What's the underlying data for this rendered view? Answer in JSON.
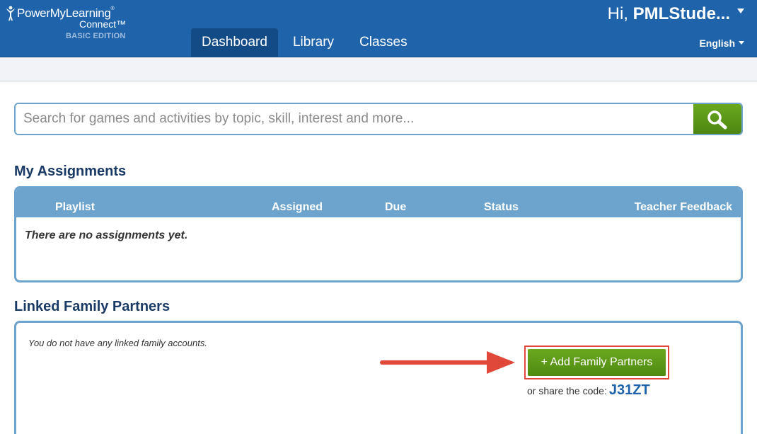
{
  "header": {
    "logo": {
      "brand": "PowerMyLearning",
      "registered": "®",
      "product": "Connect™",
      "edition": "BASIC EDITION"
    },
    "nav": [
      {
        "label": "Dashboard",
        "active": true
      },
      {
        "label": "Library",
        "active": false
      },
      {
        "label": "Classes",
        "active": false
      }
    ],
    "greeting_prefix": "Hi,",
    "user_name": "PMLStude...",
    "language": "English"
  },
  "search": {
    "placeholder": "Search for games and activities by topic, skill, interest and more...",
    "value": "",
    "button_icon": "search-icon"
  },
  "assignments": {
    "title": "My Assignments",
    "columns": [
      "Playlist",
      "Assigned",
      "Due",
      "Status",
      "Teacher Feedback"
    ],
    "empty_message": "There are no assignments yet."
  },
  "family": {
    "title": "Linked Family Partners",
    "empty_message": "You do not have any linked family accounts.",
    "add_button": "+ Add Family Partners",
    "share_prefix": "or share the code:",
    "share_code": "J31ZT"
  },
  "colors": {
    "header_bg": "#1f64aa",
    "panel_border": "#6ca4cd",
    "green": "#5a9a18",
    "highlight_red": "#e0483a"
  }
}
